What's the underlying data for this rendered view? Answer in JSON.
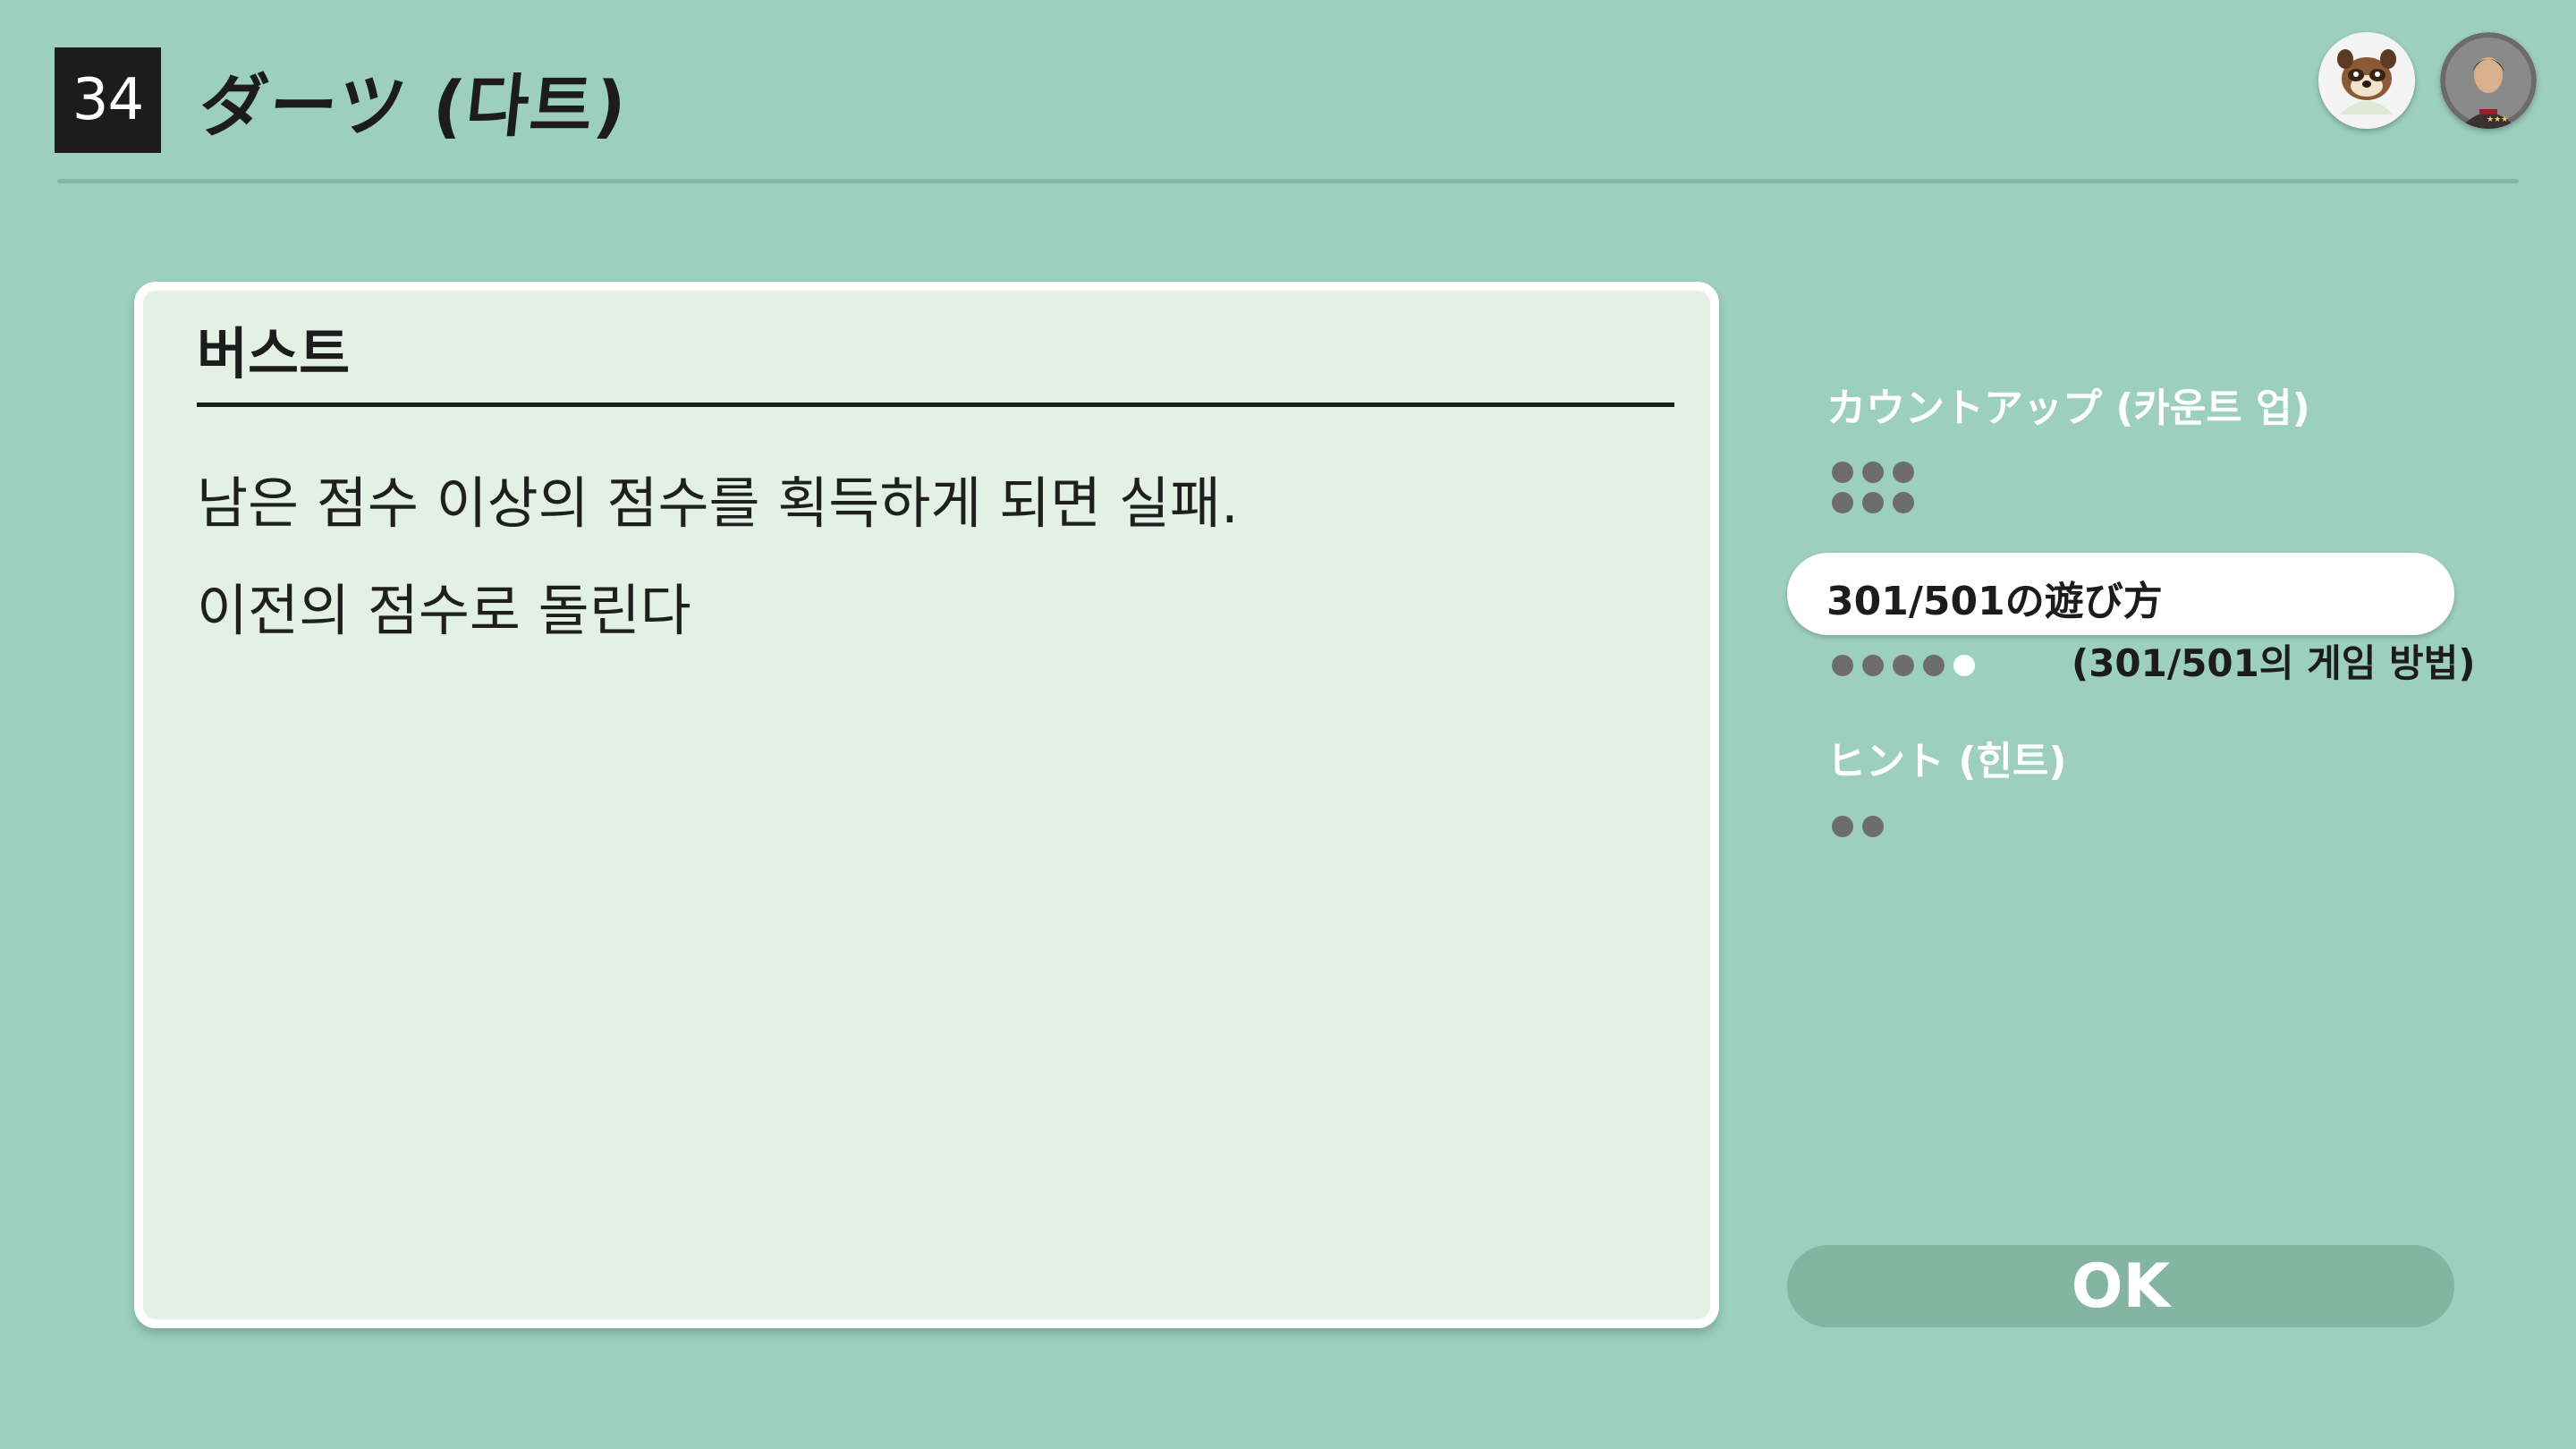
{
  "header": {
    "game_number": "34",
    "title": "ダーツ (다트)"
  },
  "avatars": [
    {
      "icon": "tanuki-character-icon"
    },
    {
      "icon": "user-avatar-icon"
    }
  ],
  "panel": {
    "heading": "버스트",
    "lines": [
      "남은 점수 이상의 점수를 획득하게 되면 실패.",
      "이전의 점수로 돌린다"
    ]
  },
  "sidebar": {
    "items": [
      {
        "label": "カウントアップ (카운트 업)",
        "pages_total": 6,
        "page_current": 0,
        "selected": false
      },
      {
        "label": "301/501の遊び方",
        "pages_total": 5,
        "page_current": 5,
        "selected": true
      },
      {
        "label": "ヒント (힌트)",
        "pages_total": 2,
        "page_current": 0,
        "selected": false
      }
    ],
    "subtitle": "(301/501의 게임 방법)",
    "ok_label": "OK"
  },
  "colors": {
    "background": "#9ccfbd",
    "panel": "#e2f0e6",
    "dark": "#1c1c1c",
    "ok_button": "#84b4a2"
  }
}
